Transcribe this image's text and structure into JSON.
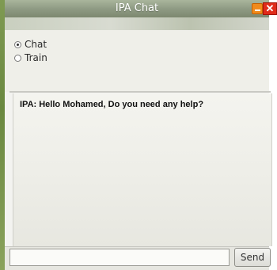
{
  "window": {
    "title": "IPA Chat",
    "minimize_icon": "minimize-icon",
    "close_icon": "close-icon",
    "close_glyph": "✕"
  },
  "mode": {
    "options": [
      {
        "label": "Chat",
        "selected": true
      },
      {
        "label": "Train",
        "selected": false
      }
    ]
  },
  "chat": {
    "messages": [
      "IPA: Hello Mohamed, Do you need any help?"
    ]
  },
  "composer": {
    "input_value": "",
    "send_label": "Send"
  },
  "colors": {
    "titlebar": "#8f9b84",
    "minimize": "#f08a1c",
    "close": "#e02a1a"
  }
}
